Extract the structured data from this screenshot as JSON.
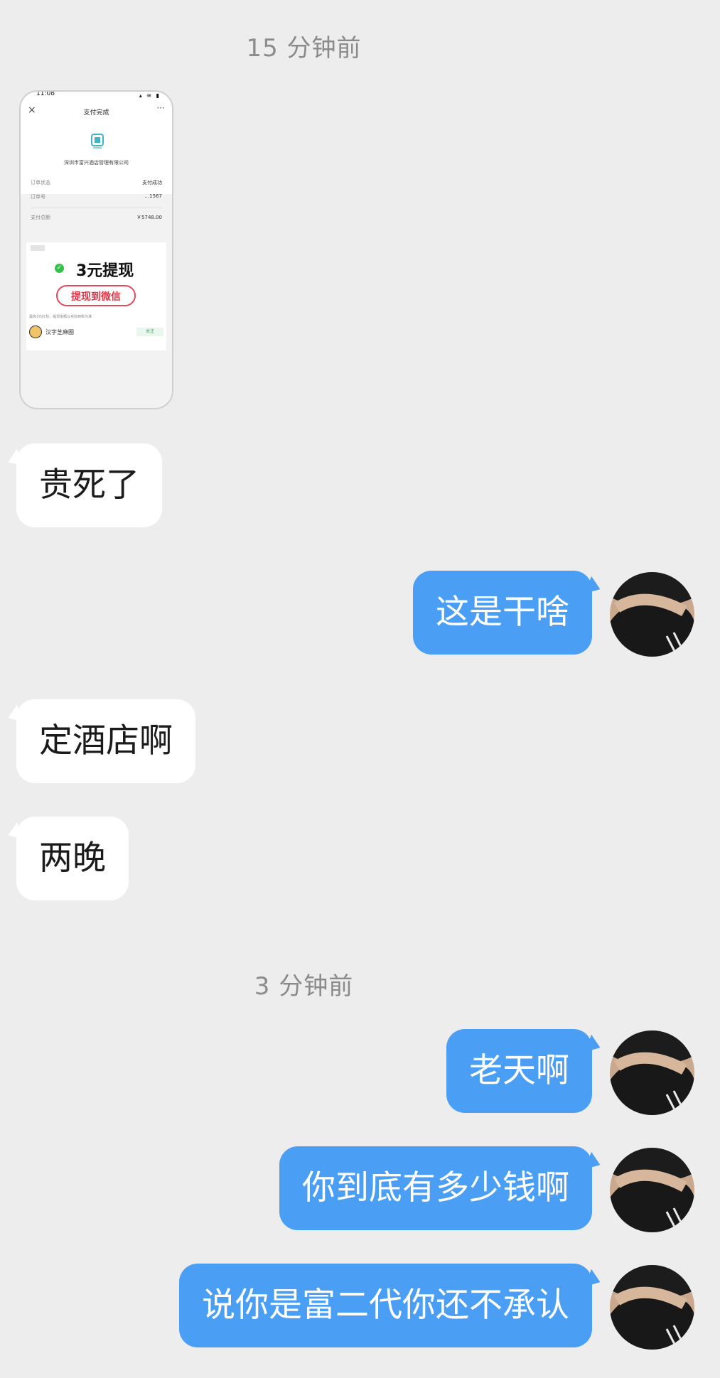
{
  "timestamps": {
    "first": "15 分钟前",
    "second": "3 分钟前"
  },
  "thumbnail": {
    "status_time": "11:08",
    "status_icons": "▴ ≋ ▮",
    "page_title": "支付完成",
    "close_glyph": "×",
    "more_glyph": "···",
    "merchant": "深圳市富兴酒店管理有限公司",
    "rows": [
      {
        "label": "订单状态",
        "value": "支付成功"
      },
      {
        "label": "订单号",
        "value": "…1567"
      },
      {
        "label": "支付总额",
        "value": "￥5748.00"
      }
    ],
    "check_glyph": "✓",
    "promo_title": "3元提现",
    "promo_button": "提现到微信",
    "promo_note": "最高3元红包，提现金额以实际到账为准",
    "account_name": "汉字芝麻圈",
    "follow_label": "关注"
  },
  "messages": [
    {
      "side": "in",
      "text": "贵死了"
    },
    {
      "side": "out",
      "text": "这是干啥"
    },
    {
      "side": "in",
      "text": "定酒店啊"
    },
    {
      "side": "in",
      "text": "两晚"
    },
    {
      "side": "out",
      "text": "老天啊"
    },
    {
      "side": "out",
      "text": "你到底有多少钱啊"
    },
    {
      "side": "out",
      "text": "说你是富二代你还不承认"
    }
  ],
  "colors": {
    "background": "#ededed",
    "incoming_bubble": "#ffffff",
    "outgoing_bubble": "#4a9ff5",
    "timestamp_text": "#8b8b8b"
  },
  "icons": {
    "avatar": "user-avatar-photo"
  }
}
